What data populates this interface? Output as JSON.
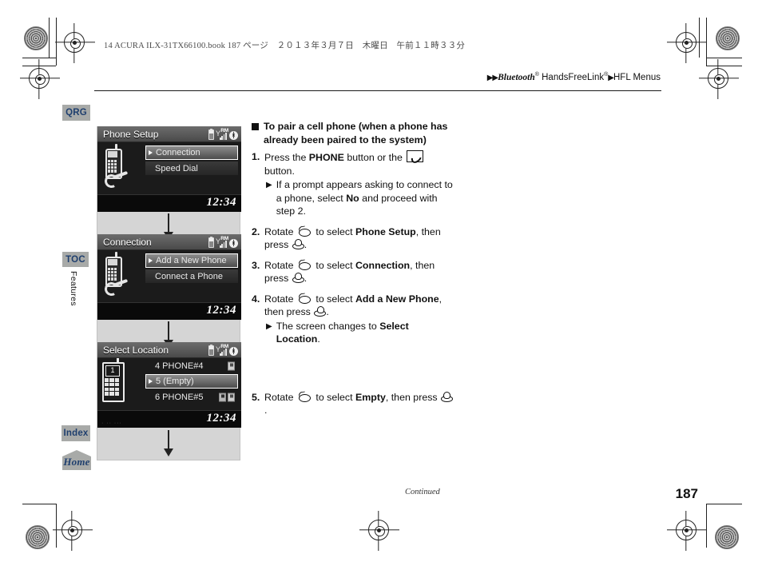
{
  "slug": "14 ACURA ILX-31TX66100.book   187 ページ　２０１３年３月７日　木曜日　午前１１時３３分",
  "running_head": {
    "arrows": "▶▶",
    "brand": "Bluetooth",
    "sup1": "®",
    "product": " HandsFreeLink",
    "sup2": "®",
    "arrow2": "▶",
    "section": "HFL Menus"
  },
  "side_tabs": [
    {
      "id": "qrg",
      "label": "QRG"
    },
    {
      "id": "toc",
      "label": "TOC"
    },
    {
      "id": "index",
      "label": "Index"
    },
    {
      "id": "home",
      "label": "Home"
    }
  ],
  "vertical_label": "Features",
  "screens": [
    {
      "title": "Phone Setup",
      "clock": "12:34",
      "status": {
        "roam": "RM"
      },
      "items": [
        {
          "label": "Connection",
          "selected": true
        },
        {
          "label": "Speed Dial",
          "selected": false
        }
      ]
    },
    {
      "title": "Connection",
      "clock": "12:34",
      "status": {
        "roam": "RM"
      },
      "items": [
        {
          "label": "Add a New Phone",
          "selected": true
        },
        {
          "label": "Connect a Phone",
          "selected": false
        }
      ]
    },
    {
      "title": "Select Location",
      "clock": "12:34",
      "status": {
        "roam": "RM"
      },
      "phone_number": "1",
      "items": [
        {
          "label": "4 PHONE#4",
          "selected": false,
          "badges": 1
        },
        {
          "label": "5 (Empty)",
          "selected": true,
          "badges": 0
        },
        {
          "label": "6 PHONE#5",
          "selected": false,
          "badges": 2
        }
      ]
    }
  ],
  "instructions": {
    "heading_part1": "To pair a cell phone (when a phone has",
    "heading_part2": "already been paired to the system)",
    "steps": [
      {
        "num": "1.",
        "pre": "Press the ",
        "bold1": "PHONE",
        "mid": " button or the ",
        "post": " button.",
        "sub": {
          "pre": "If a prompt appears asking to connect to a phone, select ",
          "bold": "No",
          "post": " and proceed with step 2."
        }
      },
      {
        "num": "2.",
        "pre": "Rotate ",
        "mid": " to select ",
        "bold1": "Phone Setup",
        "post": ", then press ",
        "end": "."
      },
      {
        "num": "3.",
        "pre": "Rotate ",
        "mid": " to select ",
        "bold1": "Connection",
        "post": ", then press ",
        "end": "."
      },
      {
        "num": "4.",
        "pre": "Rotate ",
        "mid": " to select ",
        "bold1": "Add a New Phone",
        "post": ", then press ",
        "end": ".",
        "sub": {
          "pre": "The screen changes to ",
          "bold": "Select Location",
          "post": "."
        }
      },
      {
        "num": "5.",
        "pre": "Rotate ",
        "mid": " to select ",
        "bold1": "Empty",
        "post": ", then press ",
        "end": "."
      }
    ]
  },
  "footer": {
    "continued": "Continued",
    "page_number": "187"
  },
  "colors": {
    "tab_bg": "#a8aaa8",
    "tab_text": "#1f3f6e",
    "panel_bg": "#d5d5d5",
    "screen_bg": "#1b1b1b"
  }
}
